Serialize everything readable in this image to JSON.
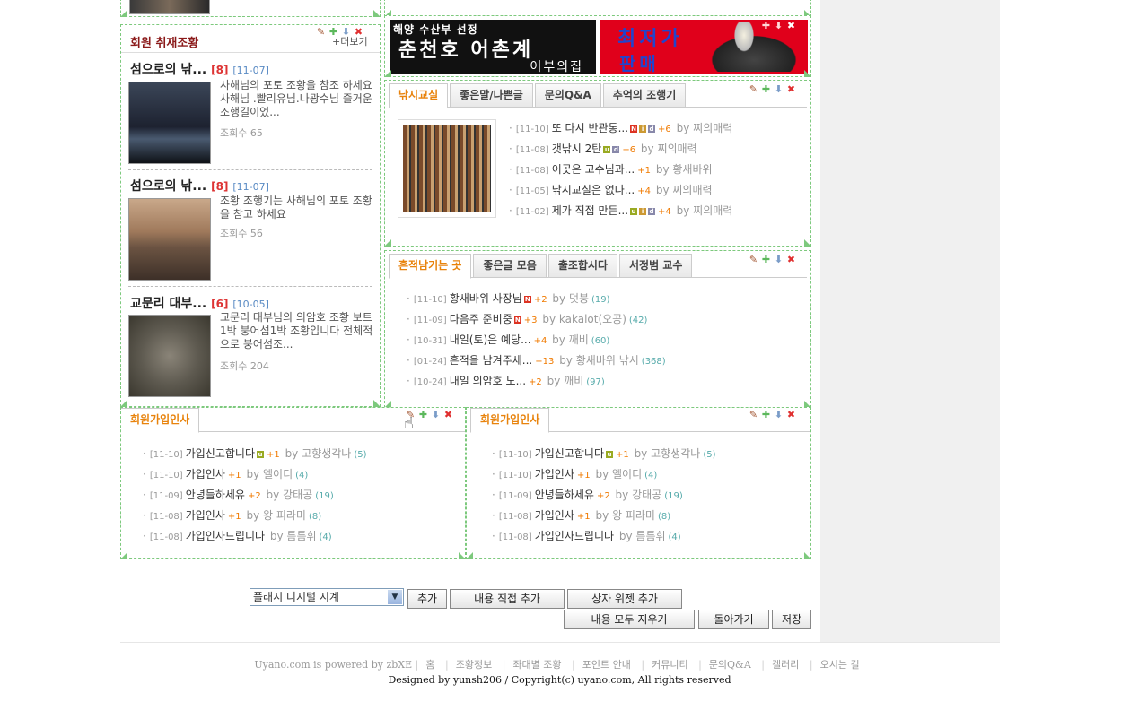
{
  "controls": {
    "edit": "✎",
    "add": "✚",
    "move": "⬇",
    "delete": "✖"
  },
  "member_photo": {
    "title": "회원 취재조황",
    "more": "+더보기",
    "items": [
      {
        "title": "섬으로의 낚...",
        "count": "[8]",
        "date": "[11-07]",
        "desc": "사해님의 포토 조황을 참조 하세요사해님 .빨리유님.나광수님 즐거운 조행길이었...",
        "views": "조회수 65"
      },
      {
        "title": "섬으로의 낚...",
        "count": "[8]",
        "date": "[11-07]",
        "desc": "조황 조행기는 사해님의 포토 조황을 참고 하세요",
        "views": "조회수 56"
      },
      {
        "title": "교문리 대부...",
        "count": "[6]",
        "date": "[10-05]",
        "desc": "교문리 대부님의 의암호 조황 보트1박 붕어섬1박 조황입니다 전체적으로 붕어섬조...",
        "views": "조회수 204"
      }
    ]
  },
  "banners": {
    "b1_top": "해양 수산부 선정",
    "b1_main": "춘천호 어촌계",
    "b1_sub": "어부의집",
    "b2_main": "최저가",
    "b2_sub": "판매"
  },
  "fishing": {
    "tabs": [
      "낚시교실",
      "좋은말/나쁜글",
      "문의Q&A",
      "추억의 조행기"
    ],
    "posts": [
      {
        "date": "[11-10]",
        "title": "또 다시 반관통...",
        "badges": [
          "N",
          "i",
          "d"
        ],
        "cmt": "+6",
        "by": "by",
        "author": "찌의매력"
      },
      {
        "date": "[11-08]",
        "title": "갯낚시 2탄",
        "badges": [
          "u",
          "d"
        ],
        "cmt": "+6",
        "by": "by",
        "author": "찌의매력"
      },
      {
        "date": "[11-08]",
        "title": "이곳은 고수님과...",
        "badges": [],
        "cmt": "+1",
        "by": "by",
        "author": "황새바위"
      },
      {
        "date": "[11-05]",
        "title": "낚시교실은 없나...",
        "badges": [],
        "cmt": "+4",
        "by": "by",
        "author": "찌의매력"
      },
      {
        "date": "[11-02]",
        "title": "제가 직접 만든...",
        "badges": [
          "u",
          "i",
          "d"
        ],
        "cmt": "+4",
        "by": "by",
        "author": "찌의매력"
      }
    ]
  },
  "traces": {
    "tabs": [
      "흔적남기는 곳",
      "좋은글 모음",
      "출조합시다",
      "서정범 교수"
    ],
    "posts": [
      {
        "date": "[11-10]",
        "title": "황새바위 사장님",
        "badges": [
          "N"
        ],
        "cmt": "+2",
        "by": "by",
        "author": "멋붕",
        "cnt": "(19)"
      },
      {
        "date": "[11-09]",
        "title": "다음주 준비중",
        "badges": [
          "N"
        ],
        "cmt": "+3",
        "by": "by",
        "author": "kakalot(오공)",
        "cnt": "(42)"
      },
      {
        "date": "[10-31]",
        "title": "내일(토)은 예당...",
        "badges": [],
        "cmt": "+4",
        "by": "by",
        "author": "깨비",
        "cnt": "(60)"
      },
      {
        "date": "[01-24]",
        "title": "흔적을 남겨주세...",
        "badges": [],
        "cmt": "+13",
        "by": "by",
        "author": "황새바위 낚시",
        "cnt": "(368)"
      },
      {
        "date": "[10-24]",
        "title": "내일 의암호 노...",
        "badges": [],
        "cmt": "+2",
        "by": "by",
        "author": "깨비",
        "cnt": "(97)"
      }
    ]
  },
  "greet_left": {
    "tab": "회원가입인사",
    "posts": [
      {
        "date": "[11-10]",
        "title": "가입신고합니다",
        "badges": [
          "u"
        ],
        "cmt": "+1",
        "by": "by",
        "author": "고향생각나",
        "cnt": "(5)"
      },
      {
        "date": "[11-10]",
        "title": "가입인사",
        "badges": [],
        "cmt": "+1",
        "by": "by",
        "author": "엘이디",
        "cnt": "(4)"
      },
      {
        "date": "[11-09]",
        "title": "안녕들하세유",
        "badges": [],
        "cmt": "+2",
        "by": "by",
        "author": "강태공",
        "cnt": "(19)"
      },
      {
        "date": "[11-08]",
        "title": "가입인사",
        "badges": [],
        "cmt": "+1",
        "by": "by",
        "author": "왕 피라미",
        "cnt": "(8)"
      },
      {
        "date": "[11-08]",
        "title": "가입인사드립니다",
        "badges": [],
        "cmt": "",
        "by": "by",
        "author": "틈틈휘",
        "cnt": "(4)"
      }
    ]
  },
  "greet_right": {
    "tab": "회원가입인사",
    "posts": [
      {
        "date": "[11-10]",
        "title": "가입신고합니다",
        "badges": [
          "u"
        ],
        "cmt": "+1",
        "by": "by",
        "author": "고향생각나",
        "cnt": "(5)"
      },
      {
        "date": "[11-10]",
        "title": "가입인사",
        "badges": [],
        "cmt": "+1",
        "by": "by",
        "author": "엘이디",
        "cnt": "(4)"
      },
      {
        "date": "[11-09]",
        "title": "안녕들하세유",
        "badges": [],
        "cmt": "+2",
        "by": "by",
        "author": "강태공",
        "cnt": "(19)"
      },
      {
        "date": "[11-08]",
        "title": "가입인사",
        "badges": [],
        "cmt": "+1",
        "by": "by",
        "author": "왕 피라미",
        "cnt": "(8)"
      },
      {
        "date": "[11-08]",
        "title": "가입인사드립니다",
        "badges": [],
        "cmt": "",
        "by": "by",
        "author": "틈틈휘",
        "cnt": "(4)"
      }
    ]
  },
  "toolbar": {
    "select_value": "플래시 디지털 시계",
    "add": "추가",
    "add_direct": "내용 직접 추가",
    "add_box": "상자 위젯 추가",
    "clear_all": "내용 모두 지우기",
    "back": "돌아가기",
    "save": "저장"
  },
  "footer": {
    "powered": "Uyano.com is powered by zbXE",
    "links": [
      "홈",
      "조황정보",
      "좌대별 조황",
      "포인트 안내",
      "커뮤니티",
      "문의Q&A",
      "겔러리",
      "오시는 길"
    ],
    "copyright": "Designed by yunsh206 / Copyright(c) uyano.com, All rights reserved"
  }
}
